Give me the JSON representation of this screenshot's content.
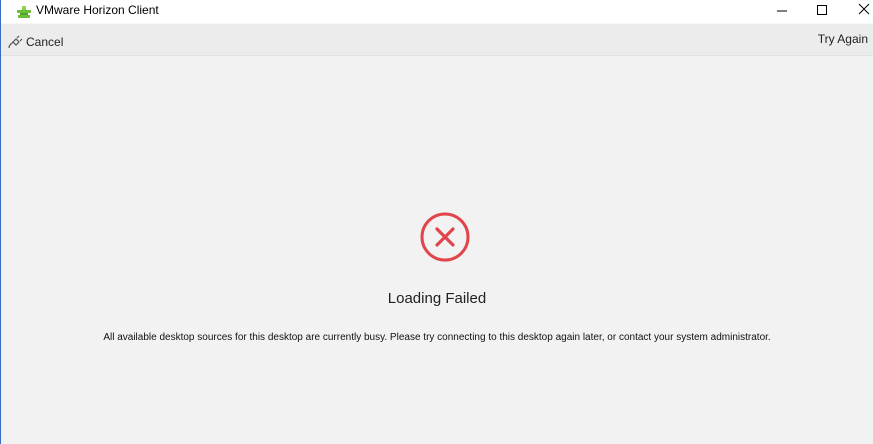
{
  "window": {
    "title": "VMware Horizon Client",
    "controls": [
      "minimize-icon",
      "maximize-icon",
      "close-icon"
    ]
  },
  "toolbar": {
    "cancel_label": "Cancel",
    "try_again_label": "Try Again"
  },
  "status": {
    "heading": "Loading Failed",
    "message": "All available desktop sources for this desktop are currently busy. Please try connecting to this desktop again later, or contact your system administrator.",
    "icon": "error-x-circle-icon"
  },
  "colors": {
    "error_red": "#e0454b",
    "app_icon_green": "#6cbf3b",
    "window_border": "#3b6cc4"
  }
}
